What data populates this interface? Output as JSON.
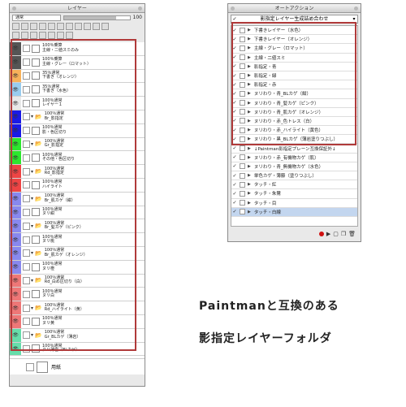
{
  "layer_panel": {
    "title": "レイヤー",
    "blend_mode": "通常",
    "opacity": "100",
    "layers": [
      {
        "color": "#555555",
        "label": "100％乗算\n主線・二値スミのみ",
        "eye": true
      },
      {
        "color": "#555555",
        "label": "100％乗算\n主線・グレー（ロマット）",
        "eye": true
      },
      {
        "color": "#f7b15a",
        "label": "35％通常\n下書き（オレンジ）",
        "eye": true
      },
      {
        "color": "#99ccee",
        "label": "35％通常\n下書き（水色）",
        "eye": true
      },
      {
        "color": "#e8e8e8",
        "label": "100％通常\nレイヤー１",
        "eye": true
      },
      {
        "color": "#1a1ae6",
        "label": "100％通常\nBr_影指定",
        "eye": true,
        "folder": true
      },
      {
        "color": "#1a1ae6",
        "label": "100％通常\n影・色区切り",
        "eye": true
      },
      {
        "color": "#2ee62e",
        "label": "100％通常\nGr_影指定",
        "eye": true,
        "folder": true
      },
      {
        "color": "#2ee62e",
        "label": "100％通常\nその他・色区切り",
        "eye": true
      },
      {
        "color": "#ee4444",
        "label": "100％通常\nRd_影指定",
        "eye": true,
        "folder": true
      },
      {
        "color": "#ee4444",
        "label": "100％通常\nハイライト",
        "eye": true
      },
      {
        "color": "#8888ee",
        "label": "100％通常\nBr_肌カゲ（紺）",
        "eye": true,
        "folder": true
      },
      {
        "color": "#8888ee",
        "label": "100％通常\nヌリ紺",
        "eye": true
      },
      {
        "color": "#8888ee",
        "label": "100％通常\nBr_髪カゲ（ピンク）",
        "eye": true,
        "folder": true
      },
      {
        "color": "#8888ee",
        "label": "100％通常\nヌリ桃",
        "eye": true
      },
      {
        "color": "#8888ee",
        "label": "100％通常\nBr_肌カゲ（オレンジ）",
        "eye": true,
        "folder": true
      },
      {
        "color": "#8888ee",
        "label": "100％通常\nヌリ橙",
        "eye": true
      },
      {
        "color": "#ee7777",
        "label": "100％通常\nRd_白め区切り（白）",
        "eye": true,
        "folder": true
      },
      {
        "color": "#ee7777",
        "label": "100％通常\nヌリ白",
        "eye": true
      },
      {
        "color": "#ee7777",
        "label": "100％通常\nRd_ハイライト（黄）",
        "eye": true,
        "folder": true
      },
      {
        "color": "#ee7777",
        "label": "100％通常\nヌリ黄",
        "eye": true
      },
      {
        "color": "#66ddaa",
        "label": "100％通常\nGr_BLカゲ（薄岩）",
        "eye": true,
        "folder": true
      },
      {
        "color": "#66ddaa",
        "label": "100％通常\nヌリ薄岩（BLカゲ）",
        "eye": true
      }
    ],
    "paper_label": "用紙"
  },
  "action_panel": {
    "title": "オートアクション",
    "set_name": "影指定レイヤー生成詰め合わせ",
    "actions": [
      {
        "label": "下書きレイヤー（水色）"
      },
      {
        "label": "下書きレイヤー（オレンジ）"
      },
      {
        "label": "主線・グレー（ロマット）"
      },
      {
        "label": "主線・二値スミ"
      },
      {
        "label": "影指定・青"
      },
      {
        "label": "影指定・緑"
      },
      {
        "label": "影指定・赤"
      },
      {
        "label": "ヌリわり・青_BLカゲ（紺）"
      },
      {
        "label": "ヌリわり・青_髪カゲ（ピンク）"
      },
      {
        "label": "ヌリわり・青_肌カゲ（オレンジ）"
      },
      {
        "label": "ヌリわり・赤_色トレス（白）"
      },
      {
        "label": "ヌリわり・赤_ハイライト（黄色）"
      },
      {
        "label": "ヌリわり・黒_BLカゲ（薄岩塗りつぶし）"
      },
      {
        "label": "↓Paintman影指定プレーン互換保証外↓"
      },
      {
        "label": "ヌリわり・赤_有機物カゲ（肌）"
      },
      {
        "label": "ヌリわり・青_無機物カゲ（水色）"
      },
      {
        "label": "単色カゲ・薄藤（塗りつぶし）"
      },
      {
        "label": "タッチ・紅"
      },
      {
        "label": "タッチ・朱鷺"
      },
      {
        "label": "タッチ・目"
      },
      {
        "label": "タッチ・白線"
      }
    ]
  },
  "caption": {
    "line1": "Paintmanと互換のある",
    "line2": "影指定レイヤーフォルダ"
  },
  "colors": {
    "highlight": "#b03a3a",
    "selection": "#c3d6ef"
  }
}
